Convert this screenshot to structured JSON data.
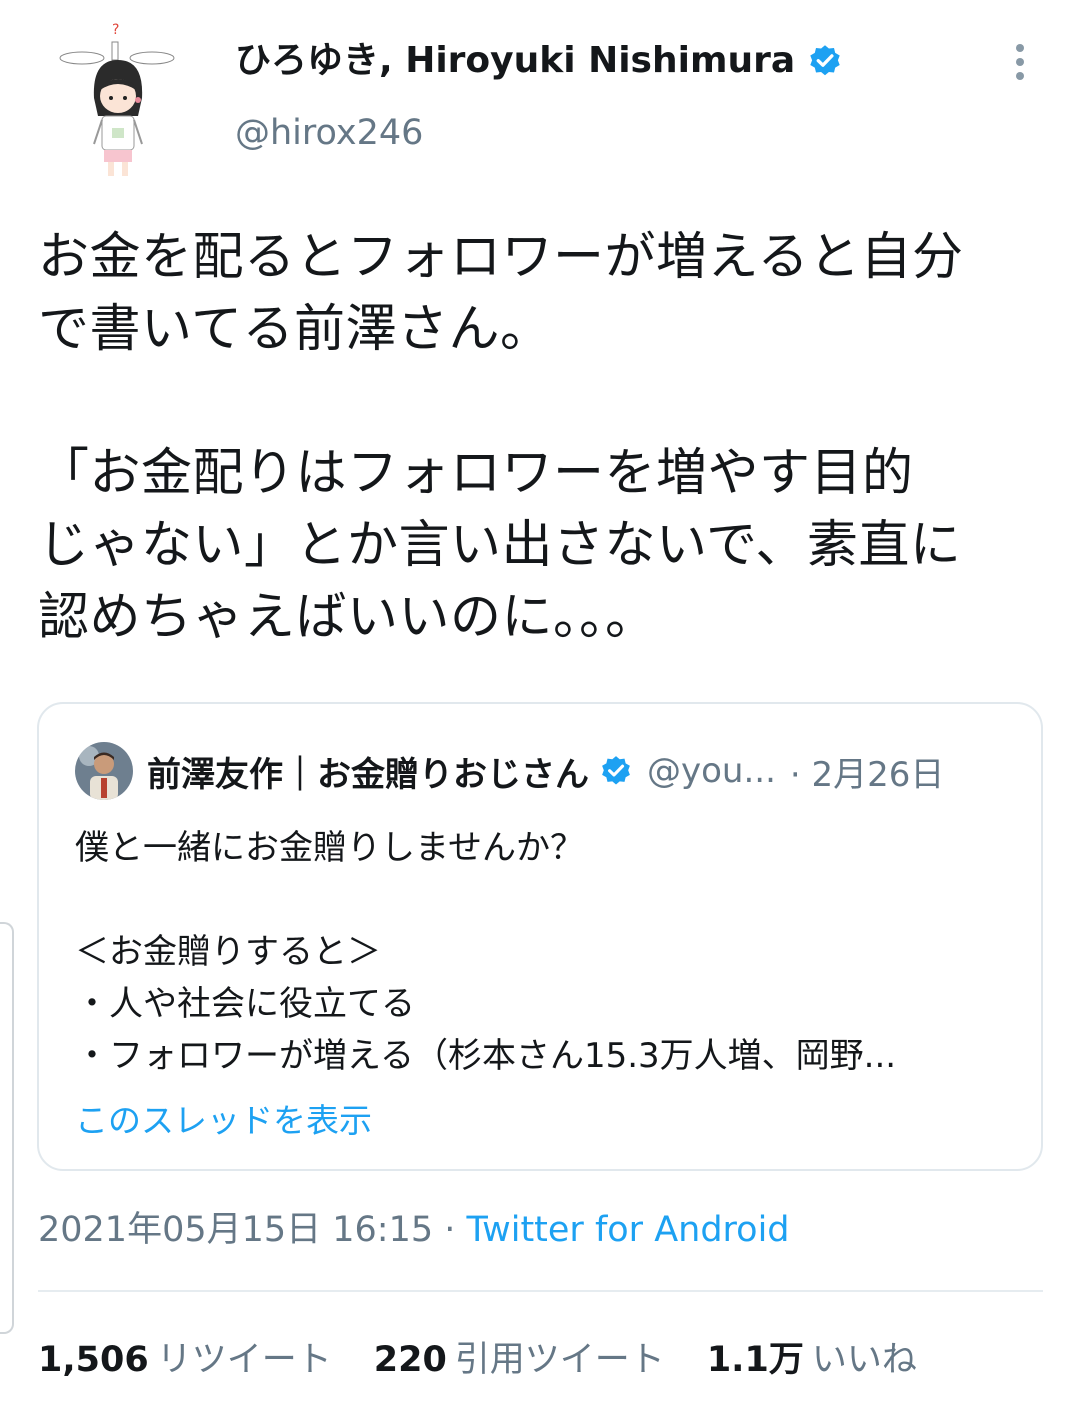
{
  "author": {
    "display_name": "ひろゆき, Hiroyuki Nishimura",
    "handle": "@hirox246",
    "verified": true
  },
  "tweet": {
    "lines_1": [
      "お金を配るとフォロワーが増えると自分",
      "で書いてる前澤さん。"
    ],
    "lines_2": [
      "「お金配りはフォロワーを増やす目的",
      "じゃない」とか言い出さないで、素直に",
      "認めちゃえばいいのに。。。"
    ]
  },
  "quote": {
    "name": "前澤友作｜お金贈りおじさん",
    "handle": "@you...",
    "date": "· 2月26日",
    "verified": true,
    "line1": "僕と一緒にお金贈りしませんか？",
    "line2": "＜お金贈りすると＞",
    "line3": "・人や社会に役立てる",
    "line4": "・フォロワーが増える（杉本さん15.3万人増、岡野...",
    "thread_link": "このスレッドを表示"
  },
  "meta": {
    "timestamp": "2021年05月15日 16:15 · ",
    "source": "Twitter for Android"
  },
  "stats": {
    "retweets_count": "1,506",
    "retweets_label": "リツイート",
    "quotes_count": "220",
    "quotes_label": "引用ツイート",
    "likes_count": "1.1万",
    "likes_label": "いいね"
  },
  "colors": {
    "accent": "#1da1f2",
    "text": "#14171a",
    "secondary": "#657786",
    "border": "#e1e8ed"
  },
  "icons": [
    "verified-badge-icon",
    "more-vertical-icon"
  ]
}
